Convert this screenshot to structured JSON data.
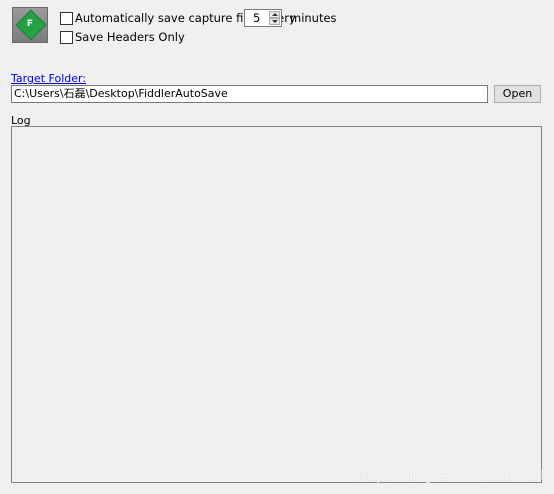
{
  "logo": {
    "letter": "F",
    "icon": "fiddler-logo-icon"
  },
  "autosave": {
    "label": "Automatically save capture files every",
    "checked": false,
    "interval_value": "5",
    "interval_unit": "minutes"
  },
  "headers_only": {
    "label": "Save Headers Only",
    "checked": false
  },
  "target_folder": {
    "link_label": "Target Folder:",
    "path": "C:\\Users\\石磊\\Desktop\\FiddlerAutoSave",
    "open_button": "Open"
  },
  "log": {
    "label": "Log",
    "content": ""
  },
  "watermark": "https://blog.csdn.net/abcnull"
}
